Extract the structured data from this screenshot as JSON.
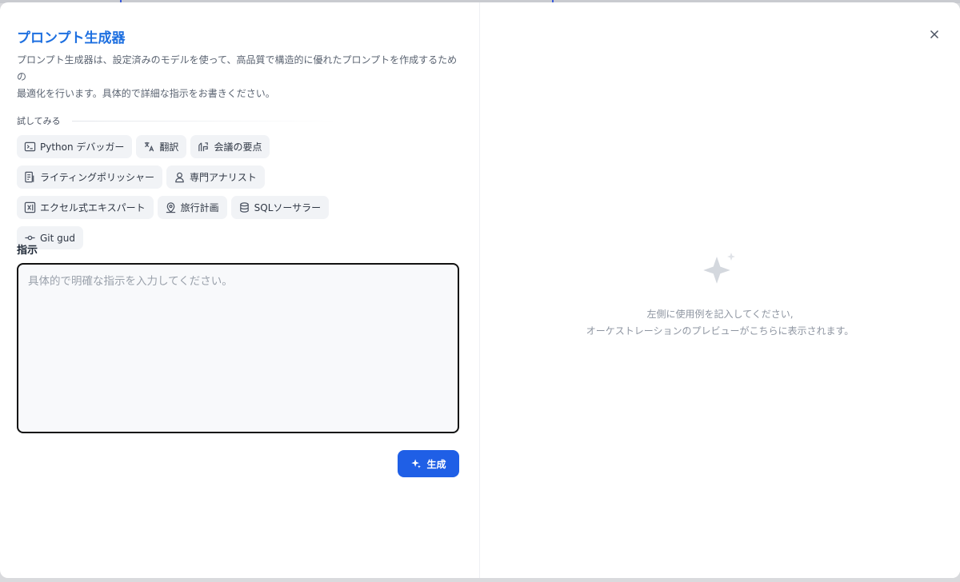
{
  "header": {
    "title": "プロンプト生成器",
    "description_line1": "プロンプト生成器は、設定済みのモデルを使って、高品質で構造的に優れたプロンプトを作成するための",
    "description_line2": "最適化を行います。具体的で詳細な指示をお書きください。"
  },
  "try_section": {
    "label": "試してみる",
    "chips": [
      {
        "label": "Python デバッガー",
        "icon": "terminal-icon"
      },
      {
        "label": "翻訳",
        "icon": "translate-icon"
      },
      {
        "label": "会議の要点",
        "icon": "meeting-icon"
      },
      {
        "label": "ライティングポリッシャー",
        "icon": "document-edit-icon"
      },
      {
        "label": "専門アナリスト",
        "icon": "user-icon"
      },
      {
        "label": "エクセル式エキスパート",
        "icon": "excel-icon"
      },
      {
        "label": "旅行計画",
        "icon": "map-pin-icon"
      },
      {
        "label": "SQLソーサラー",
        "icon": "database-icon"
      },
      {
        "label": "Git gud",
        "icon": "git-commit-icon"
      }
    ]
  },
  "instructions": {
    "label": "指示",
    "placeholder": "具体的で明確な指示を入力してください。",
    "value": ""
  },
  "generate_button": {
    "label": "生成",
    "icon": "sparkle-icon"
  },
  "close_button": {
    "icon": "close-icon"
  },
  "preview": {
    "icon": "sparkle-icon",
    "line1": "左側に使用例を記入してください,",
    "line2": "オーケストレーションのプレビューがこちらに表示されます。"
  },
  "colors": {
    "accent": "#1d6fe0",
    "button": "#1f5fe6",
    "chip_bg": "#f1f3f6",
    "muted_text": "#8e95a1"
  }
}
